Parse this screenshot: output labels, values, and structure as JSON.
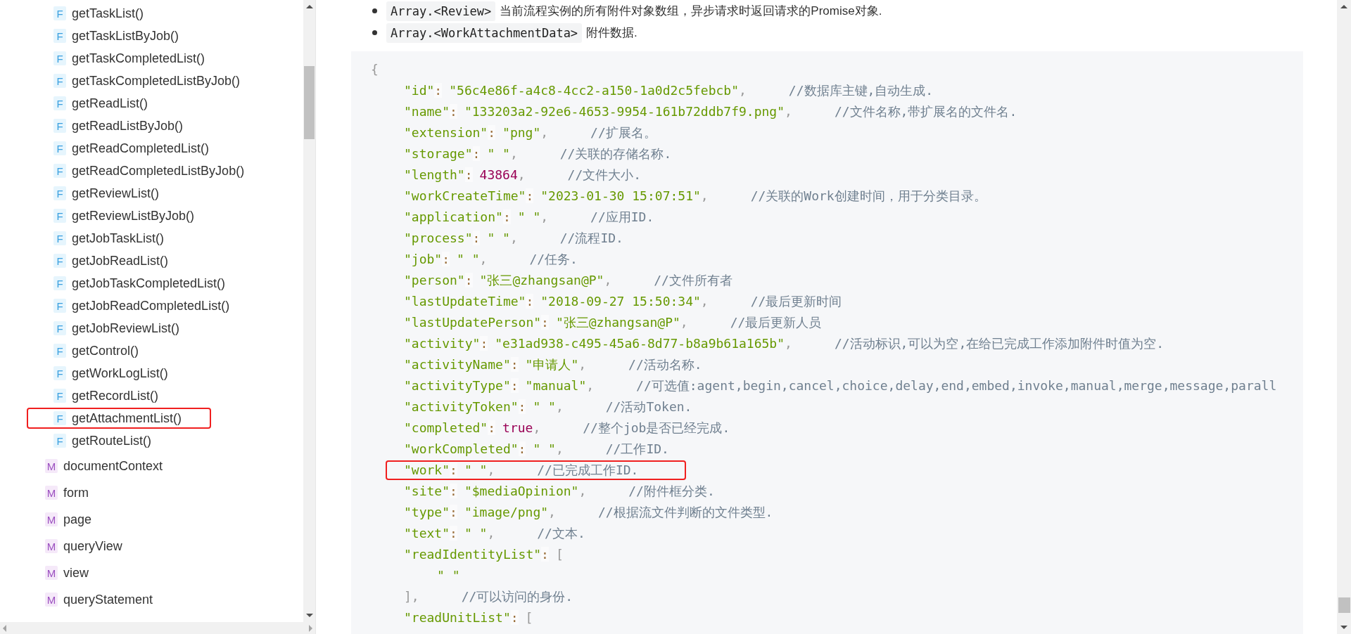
{
  "sidebar": {
    "functions": [
      {
        "badge": "F",
        "label": "getTaskList()",
        "highlighted": false
      },
      {
        "badge": "F",
        "label": "getTaskListByJob()",
        "highlighted": false
      },
      {
        "badge": "F",
        "label": "getTaskCompletedList()",
        "highlighted": false
      },
      {
        "badge": "F",
        "label": "getTaskCompletedListByJob()",
        "highlighted": false
      },
      {
        "badge": "F",
        "label": "getReadList()",
        "highlighted": false
      },
      {
        "badge": "F",
        "label": "getReadListByJob()",
        "highlighted": false
      },
      {
        "badge": "F",
        "label": "getReadCompletedList()",
        "highlighted": false
      },
      {
        "badge": "F",
        "label": "getReadCompletedListByJob()",
        "highlighted": false
      },
      {
        "badge": "F",
        "label": "getReviewList()",
        "highlighted": false
      },
      {
        "badge": "F",
        "label": "getReviewListByJob()",
        "highlighted": false
      },
      {
        "badge": "F",
        "label": "getJobTaskList()",
        "highlighted": false
      },
      {
        "badge": "F",
        "label": "getJobReadList()",
        "highlighted": false
      },
      {
        "badge": "F",
        "label": "getJobTaskCompletedList()",
        "highlighted": false
      },
      {
        "badge": "F",
        "label": "getJobReadCompletedList()",
        "highlighted": false
      },
      {
        "badge": "F",
        "label": "getJobReviewList()",
        "highlighted": false
      },
      {
        "badge": "F",
        "label": "getControl()",
        "highlighted": false
      },
      {
        "badge": "F",
        "label": "getWorkLogList()",
        "highlighted": false
      },
      {
        "badge": "F",
        "label": "getRecordList()",
        "highlighted": false
      },
      {
        "badge": "F",
        "label": "getAttachmentList()",
        "highlighted": true
      },
      {
        "badge": "F",
        "label": "getRouteList()",
        "highlighted": false
      }
    ],
    "members": [
      {
        "badge": "M",
        "label": "documentContext"
      },
      {
        "badge": "M",
        "label": "form"
      },
      {
        "badge": "M",
        "label": "page"
      },
      {
        "badge": "M",
        "label": "queryView"
      },
      {
        "badge": "M",
        "label": "view"
      },
      {
        "badge": "M",
        "label": "queryStatement"
      }
    ]
  },
  "bullets": [
    {
      "code": "Array.<Review>",
      "text": "当前流程实例的所有附件对象数组，异步请求时返回请求的Promise对象."
    },
    {
      "code": "Array.<WorkAttachmentData>",
      "text": "附件数据."
    }
  ],
  "code_block": {
    "lines": [
      {
        "highlighted": false,
        "tokens": [
          {
            "kind": "punct",
            "text": "{"
          }
        ],
        "children": [
          {
            "highlighted": false,
            "tokens": [
              {
                "kind": "key",
                "text": "\"id\""
              },
              {
                "kind": "op",
                "text": ":"
              },
              {
                "kind": "str",
                "text": "\"56c4e86f-a4c8-4cc2-a150-1a0d2c5febcb\""
              },
              {
                "kind": "punct",
                "text": ","
              },
              {
                "kind": "comment",
                "text": "//数据库主键,自动生成."
              }
            ]
          },
          {
            "highlighted": false,
            "tokens": [
              {
                "kind": "key",
                "text": "\"name\""
              },
              {
                "kind": "op",
                "text": ":"
              },
              {
                "kind": "str",
                "text": "\"133203a2-92e6-4653-9954-161b72ddb7f9.png\""
              },
              {
                "kind": "punct",
                "text": ","
              },
              {
                "kind": "comment",
                "text": "//文件名称,带扩展名的文件名."
              }
            ]
          },
          {
            "highlighted": false,
            "tokens": [
              {
                "kind": "key",
                "text": "\"extension\""
              },
              {
                "kind": "op",
                "text": ":"
              },
              {
                "kind": "str",
                "text": "\"png\""
              },
              {
                "kind": "punct",
                "text": ","
              },
              {
                "kind": "comment",
                "text": "//扩展名。"
              }
            ]
          },
          {
            "highlighted": false,
            "tokens": [
              {
                "kind": "key",
                "text": "\"storage\""
              },
              {
                "kind": "op",
                "text": ":"
              },
              {
                "kind": "str",
                "text": "\" \""
              },
              {
                "kind": "punct",
                "text": ","
              },
              {
                "kind": "comment",
                "text": "//关联的存储名称."
              }
            ]
          },
          {
            "highlighted": false,
            "tokens": [
              {
                "kind": "key",
                "text": "\"length\""
              },
              {
                "kind": "op",
                "text": ":"
              },
              {
                "kind": "num",
                "text": "43864"
              },
              {
                "kind": "punct",
                "text": ","
              },
              {
                "kind": "comment",
                "text": "//文件大小."
              }
            ]
          },
          {
            "highlighted": false,
            "tokens": [
              {
                "kind": "key",
                "text": "\"workCreateTime\""
              },
              {
                "kind": "op",
                "text": ":"
              },
              {
                "kind": "str",
                "text": "\"2023-01-30 15:07:51\""
              },
              {
                "kind": "punct",
                "text": ","
              },
              {
                "kind": "comment",
                "text": "//关联的Work创建时间，用于分类目录。"
              }
            ]
          },
          {
            "highlighted": false,
            "tokens": [
              {
                "kind": "key",
                "text": "\"application\""
              },
              {
                "kind": "op",
                "text": ":"
              },
              {
                "kind": "str",
                "text": "\" \""
              },
              {
                "kind": "punct",
                "text": ","
              },
              {
                "kind": "comment",
                "text": "//应用ID."
              }
            ]
          },
          {
            "highlighted": false,
            "tokens": [
              {
                "kind": "key",
                "text": "\"process\""
              },
              {
                "kind": "op",
                "text": ":"
              },
              {
                "kind": "str",
                "text": "\" \""
              },
              {
                "kind": "punct",
                "text": ","
              },
              {
                "kind": "comment",
                "text": "//流程ID."
              }
            ]
          },
          {
            "highlighted": false,
            "tokens": [
              {
                "kind": "key",
                "text": "\"job\""
              },
              {
                "kind": "op",
                "text": ":"
              },
              {
                "kind": "str",
                "text": "\" \""
              },
              {
                "kind": "punct",
                "text": ","
              },
              {
                "kind": "comment",
                "text": "//任务."
              }
            ]
          },
          {
            "highlighted": false,
            "tokens": [
              {
                "kind": "key",
                "text": "\"person\""
              },
              {
                "kind": "op",
                "text": ":"
              },
              {
                "kind": "str",
                "text": "\"张三@zhangsan@P\""
              },
              {
                "kind": "punct",
                "text": ","
              },
              {
                "kind": "comment",
                "text": "//文件所有者"
              }
            ]
          },
          {
            "highlighted": false,
            "tokens": [
              {
                "kind": "key",
                "text": "\"lastUpdateTime\""
              },
              {
                "kind": "op",
                "text": ":"
              },
              {
                "kind": "str",
                "text": "\"2018-09-27 15:50:34\""
              },
              {
                "kind": "punct",
                "text": ","
              },
              {
                "kind": "comment",
                "text": "//最后更新时间"
              }
            ]
          },
          {
            "highlighted": false,
            "tokens": [
              {
                "kind": "key",
                "text": "\"lastUpdatePerson\""
              },
              {
                "kind": "op",
                "text": ":"
              },
              {
                "kind": "str",
                "text": "\"张三@zhangsan@P\""
              },
              {
                "kind": "punct",
                "text": ","
              },
              {
                "kind": "comment",
                "text": "//最后更新人员"
              }
            ]
          },
          {
            "highlighted": false,
            "tokens": [
              {
                "kind": "key",
                "text": "\"activity\""
              },
              {
                "kind": "op",
                "text": ":"
              },
              {
                "kind": "str",
                "text": "\"e31ad938-c495-45a6-8d77-b8a9b61a165b\""
              },
              {
                "kind": "punct",
                "text": ","
              },
              {
                "kind": "comment",
                "text": "//活动标识,可以为空,在给已完成工作添加附件时值为空."
              }
            ]
          },
          {
            "highlighted": false,
            "tokens": [
              {
                "kind": "key",
                "text": "\"activityName\""
              },
              {
                "kind": "op",
                "text": ":"
              },
              {
                "kind": "str",
                "text": "\"申请人\""
              },
              {
                "kind": "punct",
                "text": ","
              },
              {
                "kind": "comment",
                "text": "//活动名称."
              }
            ]
          },
          {
            "highlighted": false,
            "tokens": [
              {
                "kind": "key",
                "text": "\"activityType\""
              },
              {
                "kind": "op",
                "text": ":"
              },
              {
                "kind": "str",
                "text": "\"manual\""
              },
              {
                "kind": "punct",
                "text": ","
              },
              {
                "kind": "comment",
                "text": "//可选值:agent,begin,cancel,choice,delay,end,embed,invoke,manual,merge,message,parall"
              }
            ]
          },
          {
            "highlighted": false,
            "tokens": [
              {
                "kind": "key",
                "text": "\"activityToken\""
              },
              {
                "kind": "op",
                "text": ":"
              },
              {
                "kind": "str",
                "text": "\" \""
              },
              {
                "kind": "punct",
                "text": ","
              },
              {
                "kind": "comment",
                "text": "//活动Token."
              }
            ]
          },
          {
            "highlighted": false,
            "tokens": [
              {
                "kind": "key",
                "text": "\"completed\""
              },
              {
                "kind": "op",
                "text": ":"
              },
              {
                "kind": "bool",
                "text": "true"
              },
              {
                "kind": "punct",
                "text": ","
              },
              {
                "kind": "comment",
                "text": "//整个job是否已经完成."
              }
            ]
          },
          {
            "highlighted": false,
            "tokens": [
              {
                "kind": "key",
                "text": "\"workCompleted\""
              },
              {
                "kind": "op",
                "text": ":"
              },
              {
                "kind": "str",
                "text": "\" \""
              },
              {
                "kind": "punct",
                "text": ","
              },
              {
                "kind": "comment",
                "text": "//工作ID."
              }
            ]
          },
          {
            "highlighted": true,
            "tokens": [
              {
                "kind": "key",
                "text": "\"work\""
              },
              {
                "kind": "op",
                "text": ":"
              },
              {
                "kind": "str",
                "text": "\" \""
              },
              {
                "kind": "punct",
                "text": ","
              },
              {
                "kind": "comment",
                "text": "//已完成工作ID."
              }
            ]
          },
          {
            "highlighted": false,
            "tokens": [
              {
                "kind": "key",
                "text": "\"site\""
              },
              {
                "kind": "op",
                "text": ":"
              },
              {
                "kind": "str",
                "text": "\"$mediaOpinion\""
              },
              {
                "kind": "punct",
                "text": ","
              },
              {
                "kind": "comment",
                "text": "//附件框分类."
              }
            ]
          },
          {
            "highlighted": false,
            "tokens": [
              {
                "kind": "key",
                "text": "\"type\""
              },
              {
                "kind": "op",
                "text": ":"
              },
              {
                "kind": "str",
                "text": "\"image/png\""
              },
              {
                "kind": "punct",
                "text": ","
              },
              {
                "kind": "comment",
                "text": "//根据流文件判断的文件类型."
              }
            ]
          },
          {
            "highlighted": false,
            "tokens": [
              {
                "kind": "key",
                "text": "\"text\""
              },
              {
                "kind": "op",
                "text": ":"
              },
              {
                "kind": "str",
                "text": "\" \""
              },
              {
                "kind": "punct",
                "text": ","
              },
              {
                "kind": "comment",
                "text": "//文本."
              }
            ]
          },
          {
            "highlighted": false,
            "tokens": [
              {
                "kind": "key",
                "text": "\"readIdentityList\""
              },
              {
                "kind": "op",
                "text": ":"
              },
              {
                "kind": "punct",
                "text": "["
              }
            ],
            "children": [
              {
                "highlighted": false,
                "tokens": [
                  {
                    "kind": "str",
                    "text": "\" \""
                  }
                ]
              }
            ]
          },
          {
            "highlighted": false,
            "tokens": [
              {
                "kind": "punct",
                "text": "],"
              },
              {
                "kind": "comment",
                "text": "//可以访问的身份."
              }
            ]
          },
          {
            "highlighted": false,
            "tokens": [
              {
                "kind": "key",
                "text": "\"readUnitList\""
              },
              {
                "kind": "op",
                "text": ":"
              },
              {
                "kind": "punct",
                "text": "["
              }
            ]
          }
        ]
      }
    ]
  }
}
